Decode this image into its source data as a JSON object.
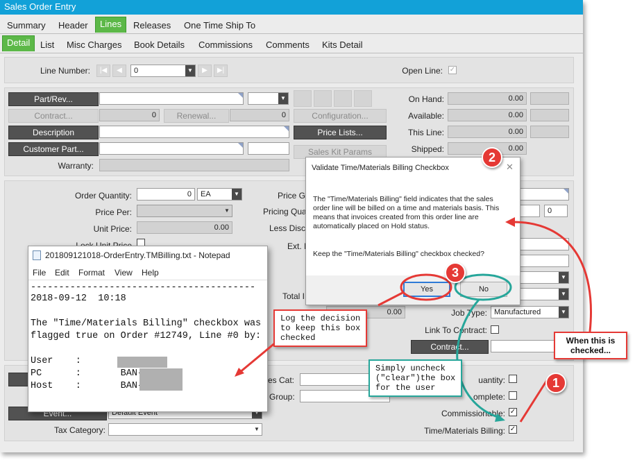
{
  "window": {
    "title": "Sales Order Entry"
  },
  "tabs_top": [
    "Summary",
    "Header",
    "Lines",
    "Releases",
    "One Time Ship To"
  ],
  "tabs_sub": [
    "Detail",
    "List",
    "Misc Charges",
    "Book Details",
    "Commissions",
    "Comments",
    "Kits Detail"
  ],
  "line": {
    "number_label": "Line Number:",
    "number_value": "0",
    "open_line_label": "Open Line:"
  },
  "part": {
    "part_btn": "Part/Rev...",
    "contract_btn": "Contract...",
    "contract_value": "0",
    "renewal_btn": "Renewal...",
    "renewal_value": "0",
    "description_btn": "Description",
    "customer_part_btn": "Customer Part...",
    "warranty_label": "Warranty:",
    "configuration_btn": "Configuration...",
    "price_lists_btn": "Price Lists...",
    "sales_kit_btn": "Sales Kit Params"
  },
  "stock": {
    "on_hand_label": "On Hand:",
    "on_hand": "0.00",
    "available_label": "Available:",
    "available": "0.00",
    "this_line_label": "This Line:",
    "this_line": "0.00",
    "shipped_label": "Shipped:",
    "shipped": "0.00"
  },
  "pricing": {
    "order_qty_label": "Order Quantity:",
    "order_qty": "0",
    "uom": "EA",
    "price_per_label": "Price Per:",
    "unit_price_label": "Unit Price:",
    "unit_price": "0.00",
    "lock_unit_price_label": "Lock Unit Price",
    "price_group_label": "Price G",
    "pricing_qty_label": "Pricing Qua",
    "pricing_qty_value": "0",
    "less_disc_label": "Less Disc",
    "ext_label": "Ext. I",
    "total_label": "Total I",
    "total_value": "0.00",
    "job_type_label": "Job Type:",
    "job_type": "Manufactured",
    "link_contract_label": "Link To Contract:",
    "contract_btn": "Contract..."
  },
  "bottom": {
    "sales_cat_label": "es Cat:",
    "group_label": "Group:",
    "event_btn": "Event...",
    "event_value": "Default Event",
    "tax_category_label": "Tax Category:",
    "quantity_label": "uantity:",
    "complete_label": "omplete:",
    "commissionable_label": "Commissionable:",
    "tm_billing_label": "Time/Materials Billing:"
  },
  "dialog": {
    "title": "Validate Time/Materials Billing Checkbox",
    "body": "The \"Time/Materials Billing\" field indicates that the sales order line will be billed on a time and materials basis.  This means that invoices created from this order line are automatically placed on Hold status.",
    "question": "Keep the \"Time/Materials Billing\" checkbox checked?",
    "yes": "Yes",
    "no": "No"
  },
  "notepad": {
    "title": "201809121018-OrderEntry.TMBilling.txt - Notepad",
    "menu": [
      "File",
      "Edit",
      "Format",
      "View",
      "Help"
    ],
    "lines": [
      "----------------------------------------",
      "2018-09-12  10:18",
      "",
      "The \"Time/Materials Billing\" checkbox was",
      "flagged true on Order #12749, Line #0 by:",
      "",
      "User    :",
      "PC      :       BAN-",
      "Host    :       BAN-"
    ]
  },
  "annotations": {
    "log_callout": "Log the decision\nto keep this box\nchecked",
    "uncheck_callout": "Simply uncheck\n(\"clear\")the box\nfor the user",
    "checked_callout": "When this is\nchecked...",
    "badge1": "1",
    "badge2": "2",
    "badge3": "3"
  },
  "colors": {
    "titlebar": "#12a1d8",
    "active_tab": "#5cb848",
    "annotation_red": "#e53935",
    "annotation_teal": "#26a69a"
  }
}
